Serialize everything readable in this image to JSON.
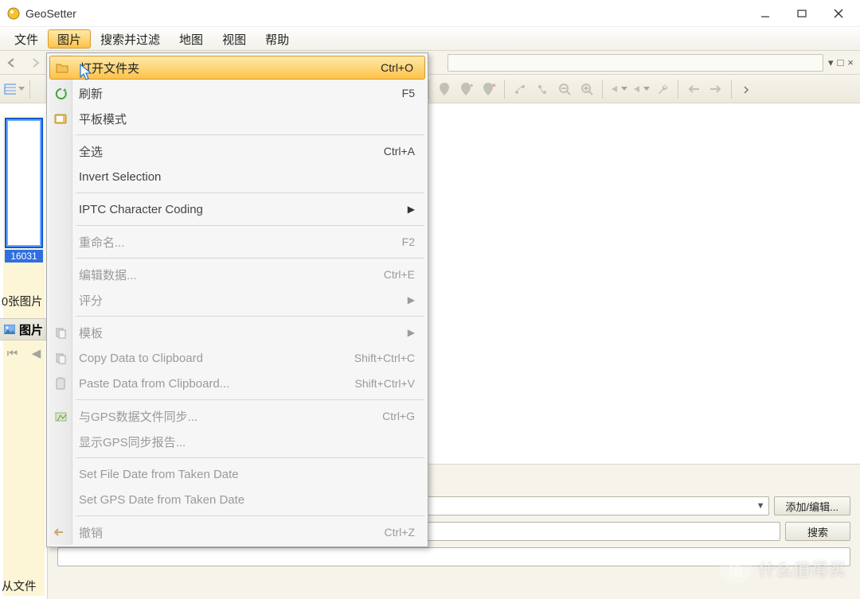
{
  "window": {
    "title": "GeoSetter"
  },
  "menubar": {
    "items": [
      "文件",
      "图片",
      "搜索并过滤",
      "地图",
      "视图",
      "帮助"
    ],
    "active_index": 1
  },
  "path_controls": {
    "dropdown_marker": "▾",
    "maximize_marker": "□",
    "close_marker": "×"
  },
  "left": {
    "thumb_label": "16031",
    "status_text": "0张图片",
    "panel_title": "图片",
    "footer_text": "从文件"
  },
  "dropdown": {
    "items": [
      {
        "label": "打开文件夹",
        "shortcut": "Ctrl+O",
        "icon": "folder-open-icon",
        "highlight": true
      },
      {
        "label": "刷新",
        "shortcut": "F5",
        "icon": "refresh-icon"
      },
      {
        "label": "平板模式",
        "icon": "tablet-icon"
      },
      {
        "sep": true
      },
      {
        "label": "全选",
        "shortcut": "Ctrl+A"
      },
      {
        "label": "Invert Selection"
      },
      {
        "sep": true
      },
      {
        "label": "IPTC Character Coding",
        "submenu": true
      },
      {
        "sep": true
      },
      {
        "label": "重命名...",
        "shortcut": "F2",
        "disabled": true
      },
      {
        "sep": true
      },
      {
        "label": "编辑数据...",
        "shortcut": "Ctrl+E",
        "disabled": true
      },
      {
        "label": "评分",
        "submenu": true,
        "disabled": true
      },
      {
        "sep": true
      },
      {
        "label": "模板",
        "submenu": true,
        "icon": "copy-icon",
        "disabled": true
      },
      {
        "label": "Copy Data to Clipboard",
        "shortcut": "Shift+Ctrl+C",
        "disabled": true,
        "icon": "copy-icon"
      },
      {
        "label": "Paste Data from Clipboard...",
        "shortcut": "Shift+Ctrl+V",
        "disabled": true,
        "icon": "paste-icon"
      },
      {
        "sep": true
      },
      {
        "label": "与GPS数据文件同步...",
        "shortcut": "Ctrl+G",
        "disabled": true,
        "icon": "sync-gps-icon"
      },
      {
        "label": "显示GPS同步报告...",
        "disabled": true
      },
      {
        "sep": true
      },
      {
        "label": "Set File Date from Taken Date",
        "disabled": true
      },
      {
        "label": "Set GPS Date from Taken Date",
        "disabled": true
      },
      {
        "sep": true
      },
      {
        "label": "撤销",
        "shortcut": "Ctrl+Z",
        "disabled": true,
        "icon": "undo-icon"
      }
    ]
  },
  "bottom": {
    "add_edit_label": "添加/编辑...",
    "search_label": "搜索"
  },
  "watermark": {
    "brand_mark": "值",
    "text": "什么值得买"
  }
}
